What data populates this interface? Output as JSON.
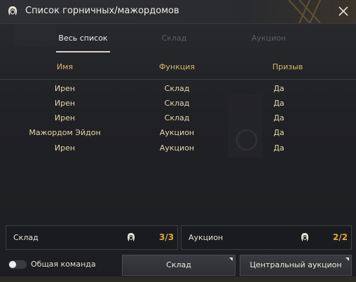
{
  "window": {
    "title": "Список горничных/мажордомов"
  },
  "tabs": [
    {
      "label": "Весь список"
    },
    {
      "label": "Склад"
    },
    {
      "label": "Аукцион"
    }
  ],
  "table": {
    "headers": [
      "Имя",
      "Функция",
      "Призыв"
    ],
    "rows": [
      [
        "Ирен",
        "Склад",
        "Да"
      ],
      [
        "Ирен",
        "Склад",
        "Да"
      ],
      [
        "Ирен",
        "Склад",
        "Да"
      ],
      [
        "Мажордом Эйдон",
        "Аукцион",
        "Да"
      ],
      [
        "Ирен",
        "Аукцион",
        "Да"
      ]
    ]
  },
  "summary": {
    "warehouse": {
      "label": "Склад",
      "count": "3/3"
    },
    "auction": {
      "label": "Аукцион",
      "count": "2/2"
    }
  },
  "footer": {
    "toggle_label": "Общая команда",
    "warehouse_button": "Склад",
    "auction_button": "Центральный аукцион"
  },
  "colors": {
    "accent": "#e2a93a",
    "header_text": "#d8b66a",
    "cell_text": "#e6d7b0"
  }
}
